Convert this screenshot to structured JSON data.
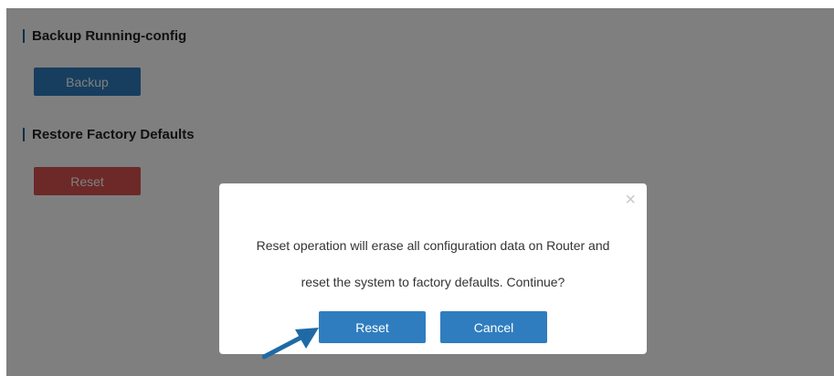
{
  "backup_section": {
    "title": "Backup Running-config",
    "button_label": "Backup"
  },
  "restore_section": {
    "title": "Restore Factory Defaults",
    "button_label": "Reset"
  },
  "dialog": {
    "close_glyph": "×",
    "message_line1": "Reset operation will erase all configuration data on Router and",
    "message_line2": "reset the system to factory defaults. Continue?",
    "confirm_label": "Reset",
    "cancel_label": "Cancel"
  },
  "colors": {
    "primary": "#2f7dbf",
    "danger": "#d9534f",
    "overlay": "rgba(0,0,0,0.5)",
    "arrow": "#1f6aa5"
  }
}
